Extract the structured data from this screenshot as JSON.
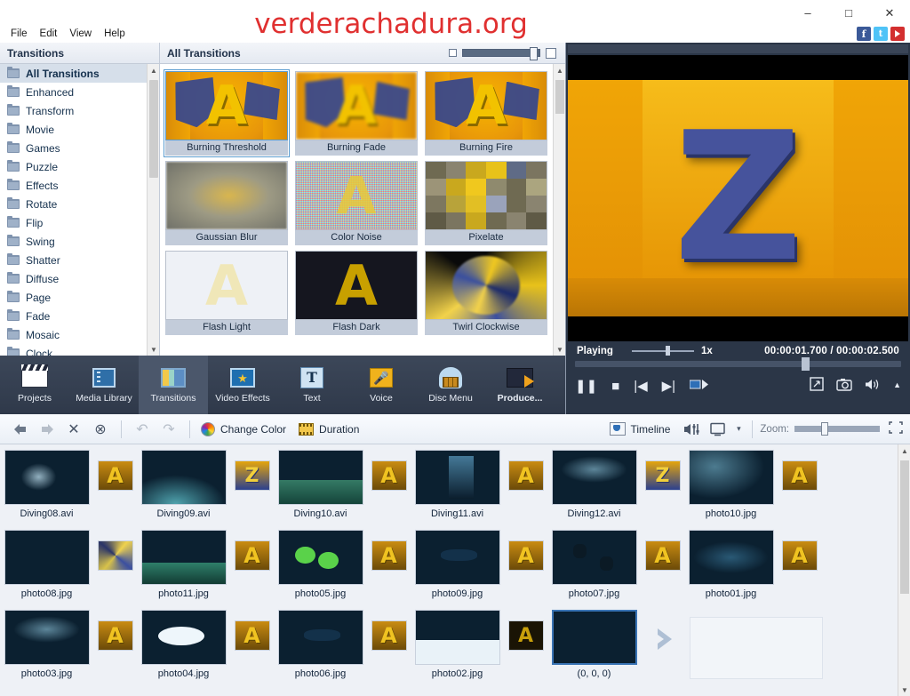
{
  "window": {
    "minimize": "–",
    "maximize": "□",
    "close": "✕"
  },
  "watermark": "verderachadura.org",
  "menubar": {
    "items": [
      "File",
      "Edit",
      "View",
      "Help"
    ]
  },
  "social": {
    "facebook": "f",
    "twitter": "t",
    "youtube": "youtube-play"
  },
  "panels": {
    "left_header": "Transitions",
    "grid_header": "All Transitions"
  },
  "sidebar": {
    "items": [
      {
        "label": "All Transitions",
        "active": true
      },
      {
        "label": "Enhanced",
        "active": false
      },
      {
        "label": "Transform",
        "active": false
      },
      {
        "label": "Movie",
        "active": false
      },
      {
        "label": "Games",
        "active": false
      },
      {
        "label": "Puzzle",
        "active": false
      },
      {
        "label": "Effects",
        "active": false
      },
      {
        "label": "Rotate",
        "active": false
      },
      {
        "label": "Flip",
        "active": false
      },
      {
        "label": "Swing",
        "active": false
      },
      {
        "label": "Shatter",
        "active": false
      },
      {
        "label": "Diffuse",
        "active": false
      },
      {
        "label": "Page",
        "active": false
      },
      {
        "label": "Fade",
        "active": false
      },
      {
        "label": "Mosaic",
        "active": false
      },
      {
        "label": "Clock",
        "active": false
      }
    ]
  },
  "transitions": {
    "items": [
      {
        "label": "Burning Threshold",
        "art": "a-shards",
        "selected": true
      },
      {
        "label": "Burning Fade",
        "art": "a-fade",
        "selected": false
      },
      {
        "label": "Burning Fire",
        "art": "a-fire",
        "selected": false
      },
      {
        "label": "Gaussian Blur",
        "art": "blur",
        "selected": false
      },
      {
        "label": "Color Noise",
        "art": "noise",
        "selected": false
      },
      {
        "label": "Pixelate",
        "art": "pixelate",
        "selected": false
      },
      {
        "label": "Flash Light",
        "art": "flash-light",
        "selected": false
      },
      {
        "label": "Flash Dark",
        "art": "flash-dark",
        "selected": false
      },
      {
        "label": "Twirl Clockwise",
        "art": "twirl",
        "selected": false
      }
    ]
  },
  "preview": {
    "status": "Playing",
    "speed": "1x",
    "time_current": "00:00:01.700",
    "time_separator": "/",
    "time_total": "00:00:02.500",
    "stage_glyph": "Z"
  },
  "player": {
    "pause": "❚❚",
    "stop": "■",
    "prev": "|◀",
    "next": "▶|",
    "step": "▶",
    "fullscreen": "⤢",
    "snapshot": "snapshot-icon",
    "volume": "🔊",
    "volume_caret": "▲"
  },
  "tabs": [
    {
      "label": "Projects",
      "icon": "clapboard-icon",
      "active": false
    },
    {
      "label": "Media Library",
      "icon": "film-icon",
      "active": false
    },
    {
      "label": "Transitions",
      "icon": "transitions-icon",
      "active": true
    },
    {
      "label": "Video Effects",
      "icon": "star-icon",
      "active": false
    },
    {
      "label": "Text",
      "icon": "text-icon",
      "active": false
    },
    {
      "label": "Voice",
      "icon": "microphone-icon",
      "active": false
    },
    {
      "label": "Disc Menu",
      "icon": "disc-icon",
      "active": false
    },
    {
      "label": "Produce...",
      "icon": "produce-icon",
      "active": false
    }
  ],
  "edit_toolbar": {
    "back": "◀",
    "forward": "▶",
    "delete": "✕",
    "delete_all": "⊗",
    "undo": "↶",
    "redo": "↷",
    "change_color": "Change Color",
    "duration": "Duration",
    "timeline": "Timeline",
    "audio_mixer": "audio-mixer-icon",
    "view_mode": "monitor-icon",
    "view_caret": "▾",
    "zoom_label": "Zoom:",
    "fit": "fit-icon"
  },
  "storyboard": {
    "rows": [
      {
        "clips": [
          {
            "type": "clip",
            "name": "Diving08.avi",
            "art": "u1"
          },
          {
            "type": "transition",
            "art": "mini-a"
          },
          {
            "type": "clip",
            "name": "Diving09.avi",
            "art": "u2"
          },
          {
            "type": "transition",
            "art": "mini-z"
          },
          {
            "type": "clip",
            "name": "Diving10.avi",
            "art": "u3"
          },
          {
            "type": "transition",
            "art": "mini-a"
          },
          {
            "type": "clip",
            "name": "Diving11.avi",
            "art": "u4"
          },
          {
            "type": "transition",
            "art": "mini-a"
          },
          {
            "type": "clip",
            "name": "Diving12.avi",
            "art": "u5"
          },
          {
            "type": "transition",
            "art": "mini-z"
          },
          {
            "type": "clip",
            "name": "photo10.jpg",
            "art": "u15"
          },
          {
            "type": "transition",
            "art": "mini-a"
          }
        ]
      },
      {
        "clips": [
          {
            "type": "clip",
            "name": "photo08.jpg",
            "art": "u7"
          },
          {
            "type": "transition",
            "art": "mini-swirl"
          },
          {
            "type": "clip",
            "name": "photo11.jpg",
            "art": "u10"
          },
          {
            "type": "transition",
            "art": "mini-a"
          },
          {
            "type": "clip",
            "name": "photo05.jpg",
            "art": "u6"
          },
          {
            "type": "transition",
            "art": "mini-a"
          },
          {
            "type": "clip",
            "name": "photo09.jpg",
            "art": "u12"
          },
          {
            "type": "transition",
            "art": "mini-a"
          },
          {
            "type": "clip",
            "name": "photo07.jpg",
            "art": "u8"
          },
          {
            "type": "transition",
            "art": "mini-a"
          },
          {
            "type": "clip",
            "name": "photo01.jpg",
            "art": "u9"
          },
          {
            "type": "transition",
            "art": "mini-a"
          }
        ]
      },
      {
        "clips": [
          {
            "type": "clip",
            "name": "photo03.jpg",
            "art": "u5"
          },
          {
            "type": "transition",
            "art": "mini-a"
          },
          {
            "type": "clip",
            "name": "photo04.jpg",
            "art": "u11"
          },
          {
            "type": "transition",
            "art": "mini-a"
          },
          {
            "type": "clip",
            "name": "photo06.jpg",
            "art": "u12"
          },
          {
            "type": "transition",
            "art": "mini-a"
          },
          {
            "type": "clip",
            "name": "photo02.jpg",
            "art": "u13"
          },
          {
            "type": "transition",
            "art": "mini-dark"
          },
          {
            "type": "clip",
            "name": "(0, 0, 0)",
            "art": "blackclip",
            "selected": true
          },
          {
            "type": "chevron"
          },
          {
            "type": "empty"
          }
        ]
      }
    ]
  }
}
